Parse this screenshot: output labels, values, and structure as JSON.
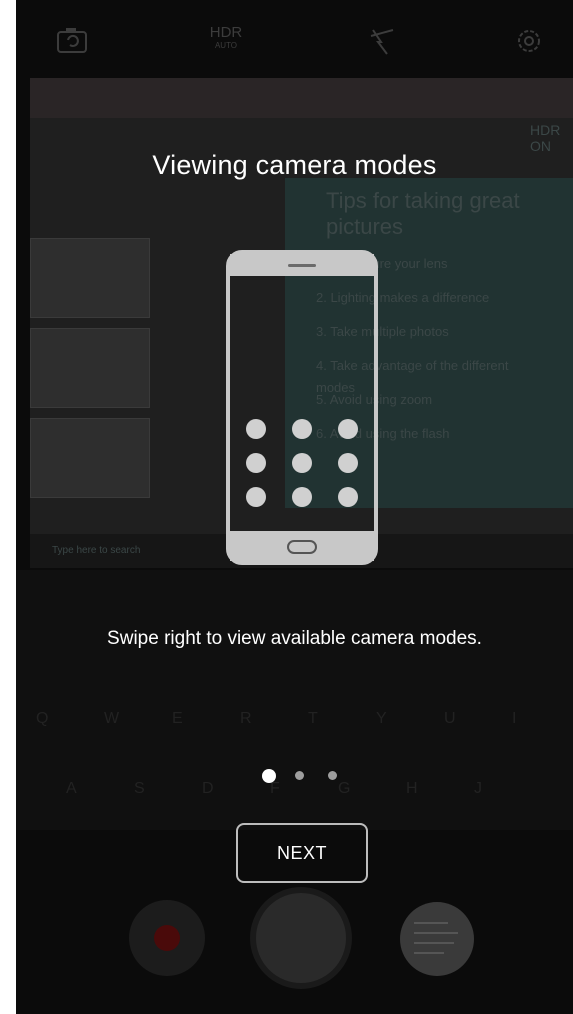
{
  "top_bar": {
    "icons": [
      "switch-camera-icon",
      "hdr-auto-icon",
      "flash-off-icon",
      "settings-icon"
    ],
    "hdr_label": "HDR",
    "hdr_sub": "AUTO"
  },
  "tutorial": {
    "title": "Viewing camera modes",
    "subtitle": "Swipe right to view available camera modes.",
    "next_label": "NEXT",
    "page_count": 3,
    "current_page": 1
  },
  "colors": {
    "overlay_text": "#ffffff",
    "active_dot": "#ffffff",
    "inactive_dot": "#9e9e9e",
    "button_border": "#bdbdbd"
  },
  "preview_text": {
    "heading": "Tips for taking great pictures",
    "items": [
      "1. Make sure your lens",
      "2. Lighting makes a difference",
      "3. Take multiple photos",
      "4. Take advantage of the different modes",
      "5. Avoid using zoom",
      "6. Avoid using the flash"
    ],
    "hdr_badge_1": "HDR",
    "hdr_badge_2": "ON",
    "taskbar_search": "Type here to search"
  },
  "keyboard_rows": [
    [
      "Q",
      "W",
      "E",
      "R",
      "T",
      "Y",
      "U",
      "I"
    ],
    [
      "A",
      "S",
      "D",
      "F",
      "G",
      "H",
      "J"
    ]
  ]
}
